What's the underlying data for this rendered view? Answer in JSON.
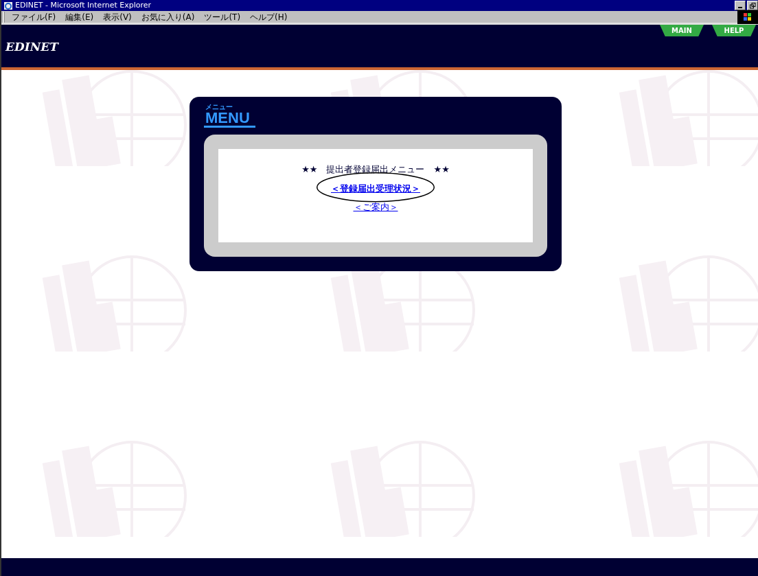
{
  "window": {
    "title": "EDINET - Microsoft Internet Explorer"
  },
  "menu_bar": [
    "ファイル(F)",
    "編集(E)",
    "表示(V)",
    "お気に入り(A)",
    "ツール(T)",
    "ヘルプ(H)"
  ],
  "header": {
    "logo": "EDINET",
    "tabs": [
      {
        "label": "MAIN"
      },
      {
        "label": "HELP"
      }
    ]
  },
  "menu_panel": {
    "caption_ruby": "メニュー",
    "caption": "MENU",
    "heading": "★★　提出者登録届出メニュー　★★",
    "links": [
      {
        "label": "＜登録届出受理状況＞",
        "circled": true
      },
      {
        "label": "＜ご案内＞",
        "circled": false
      }
    ]
  }
}
